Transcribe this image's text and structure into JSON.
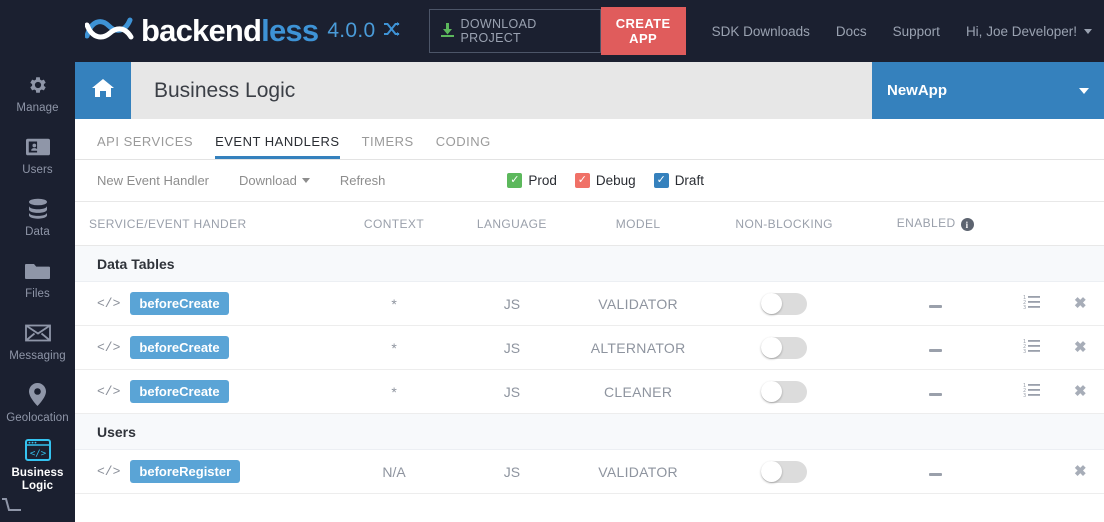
{
  "topbar": {
    "logo_text_1": "backend",
    "logo_text_2": "less",
    "version": "4.0.0",
    "download_label": "DOWNLOAD PROJECT",
    "create_app_label": "CREATE APP",
    "links": [
      "SDK Downloads",
      "Docs",
      "Support"
    ],
    "user_label": "Hi, Joe Developer!",
    "brand_blue": "#3e93d6",
    "create_app_red": "#e05c5c",
    "bar_bg": "#1b2030"
  },
  "sidebar": {
    "items": [
      {
        "label": "Manage",
        "icon": "gear-icon",
        "active": false
      },
      {
        "label": "Users",
        "icon": "users-card-icon",
        "active": false
      },
      {
        "label": "Data",
        "icon": "database-icon",
        "active": false
      },
      {
        "label": "Files",
        "icon": "folder-icon",
        "active": false
      },
      {
        "label": "Messaging",
        "icon": "envelope-icon",
        "active": false
      },
      {
        "label": "Geolocation",
        "icon": "map-pin-icon",
        "active": false
      },
      {
        "label": "Business Logic",
        "icon": "code-window-icon",
        "active": true
      }
    ],
    "active_color": "#35c3f0"
  },
  "titlebar": {
    "home_icon": "home-icon",
    "title": "Business Logic",
    "app_name": "NewApp",
    "accent": "#3581bd"
  },
  "tabs": [
    {
      "label": "API SERVICES",
      "active": false
    },
    {
      "label": "EVENT HANDLERS",
      "active": true
    },
    {
      "label": "TIMERS",
      "active": false
    },
    {
      "label": "CODING",
      "active": false
    }
  ],
  "toolbar": {
    "new_handler_label": "New Event Handler",
    "download_label": "Download",
    "refresh_label": "Refresh",
    "filters": [
      {
        "label": "Prod",
        "checked": true,
        "color": "#5cb85c"
      },
      {
        "label": "Debug",
        "checked": true,
        "color": "#f07167"
      },
      {
        "label": "Draft",
        "checked": true,
        "color": "#3581bd"
      }
    ]
  },
  "table": {
    "headers": {
      "name": "SERVICE/EVENT HANDER",
      "context": "CONTEXT",
      "language": "LANGUAGE",
      "model": "MODEL",
      "non_blocking": "NON-BLOCKING",
      "enabled": "ENABLED"
    },
    "groups": [
      {
        "title": "Data Tables",
        "rows": [
          {
            "name": "beforeCreate",
            "context": "*",
            "language": "JS",
            "model": "VALIDATOR",
            "non_blocking": false,
            "enabled": "-",
            "has_list_icon": true
          },
          {
            "name": "beforeCreate",
            "context": "*",
            "language": "JS",
            "model": "ALTERNATOR",
            "non_blocking": false,
            "enabled": "-",
            "has_list_icon": true
          },
          {
            "name": "beforeCreate",
            "context": "*",
            "language": "JS",
            "model": "CLEANER",
            "non_blocking": false,
            "enabled": "-",
            "has_list_icon": true
          }
        ]
      },
      {
        "title": "Users",
        "rows": [
          {
            "name": "beforeRegister",
            "context": "N/A",
            "language": "JS",
            "model": "VALIDATOR",
            "non_blocking": false,
            "enabled": "-",
            "has_list_icon": false
          }
        ]
      }
    ],
    "badge_color": "#5aa4d6"
  }
}
